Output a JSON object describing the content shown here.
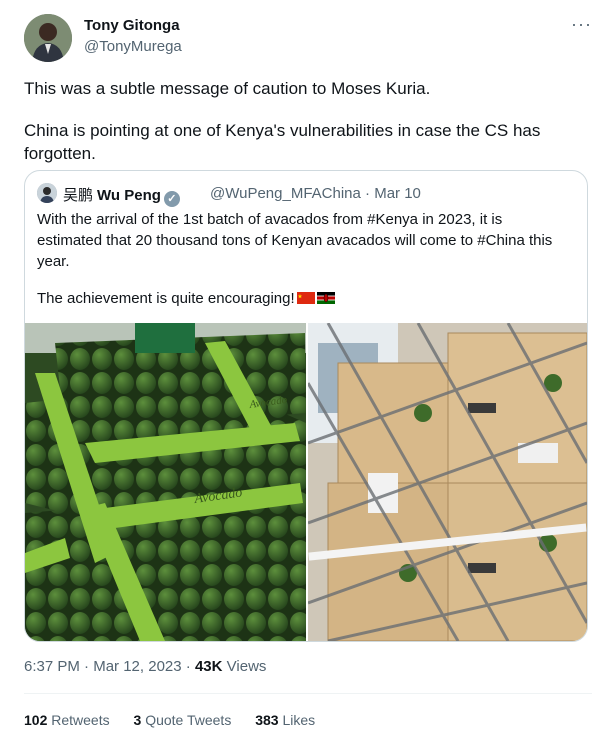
{
  "author": {
    "name": "Tony Gitonga",
    "handle": "@TonyMurega"
  },
  "more_label": "···",
  "tweet": {
    "paragraph1": "This was a subtle message of caution to Moses Kuria.",
    "paragraph2_line1": "China is pointing at one of Kenya's vulnerabilities in case the CS has",
    "paragraph2_line2": "forgotten."
  },
  "quoted": {
    "name_cn": "吴鹏",
    "name": "Wu Peng",
    "handle": "@WuPeng_MFAChina",
    "separator": "·",
    "date": "Mar 10",
    "line1": "With the arrival of the 1st batch of avacados from #Kenya in 2023, it is",
    "line2": "estimated that 20 thousand tons of Kenyan avacados will come to #China this",
    "line3": "year.",
    "line4": "The achievement is quite encouraging!",
    "flags": [
      "china-flag",
      "kenya-flag"
    ]
  },
  "meta": {
    "time": "6:37 PM",
    "sep1": "·",
    "date": "Mar 12, 2023",
    "sep2": "·",
    "views_count": "43K",
    "views_label": "Views"
  },
  "stats": {
    "retweets_count": "102",
    "retweets_label": "Retweets",
    "quotes_count": "3",
    "quotes_label": "Quote Tweets",
    "likes_count": "383",
    "likes_label": "Likes"
  },
  "colors": {
    "text": "#0f1419",
    "secondary": "#536471",
    "border": "#cfd9de",
    "box_green": "#8cc63f",
    "avocado": "#3e6b2a"
  }
}
